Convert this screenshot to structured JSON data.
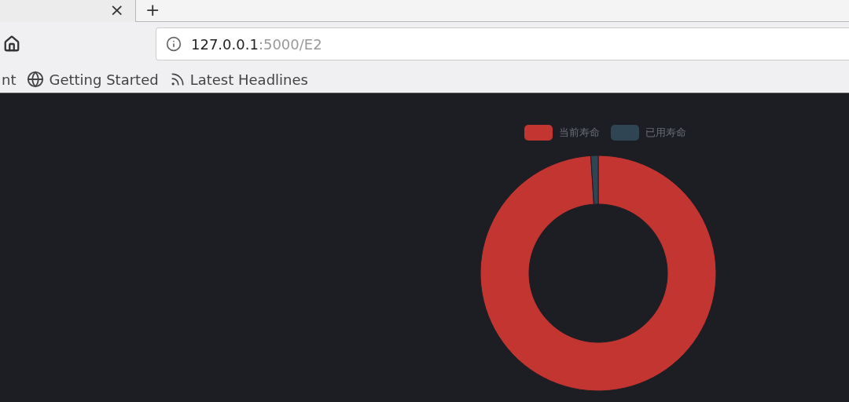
{
  "tab_bar": {
    "close_symbol": "×",
    "new_tab_symbol": "+"
  },
  "address_bar": {
    "host": "127.0.0.1",
    "rest": ":5000/E2"
  },
  "bookmarks": [
    {
      "label": "nt",
      "kind": "plain"
    },
    {
      "label": "Getting Started",
      "kind": "globe"
    },
    {
      "label": "Latest Headlines",
      "kind": "feed"
    }
  ],
  "chart": {
    "legend": [
      {
        "label": "当前寿命",
        "color": "#c23531"
      },
      {
        "label": "已用寿命",
        "color": "#2f4554"
      }
    ]
  }
}
